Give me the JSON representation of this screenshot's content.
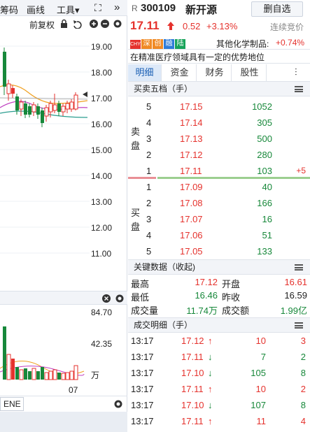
{
  "toolbar": {
    "item1": "筹码",
    "item2": "画线",
    "item3": "工具▾",
    "expand_glyph": "⛶",
    "more_glyph": "»"
  },
  "subbar": {
    "adjust": "前复权"
  },
  "price_axis": [
    "19.00",
    "18.00",
    "17.00",
    "16.00",
    "15.00",
    "14.00",
    "13.00",
    "12.00",
    "11.00"
  ],
  "volume_axis": {
    "top": "84.70",
    "mid": "42.35",
    "unit": "万"
  },
  "date_label": "07",
  "indicator_tab": "ENE",
  "stock": {
    "prefix": "R",
    "code": "300109",
    "name": "新开源",
    "remove_button": "删自选",
    "price": "17.11",
    "change": "0.52",
    "change_pct": "+3.13%",
    "auction_status": "连续竞价",
    "badges": [
      {
        "text": "CHY",
        "color": "#e5322d"
      },
      {
        "text": "深",
        "color": "#f08a24"
      },
      {
        "text": "创",
        "color": "#f08a24"
      },
      {
        "text": "融",
        "color": "#2f7cd8"
      },
      {
        "text": "陆",
        "color": "#17a35a"
      }
    ],
    "industry_label": "其他化学制品:",
    "industry_change": "+0.74%",
    "tagline": "在精准医疗领域具有一定的优势地位"
  },
  "tabs": [
    "明细",
    "资金",
    "财务",
    "股性"
  ],
  "orderbook": {
    "title": "买卖五档（手）",
    "sell_label": "卖盘",
    "buy_label": "买盘",
    "sell": [
      {
        "level": "5",
        "price": "17.15",
        "volume": "1052"
      },
      {
        "level": "4",
        "price": "17.14",
        "volume": "305"
      },
      {
        "level": "3",
        "price": "17.13",
        "volume": "500"
      },
      {
        "level": "2",
        "price": "17.12",
        "volume": "280"
      },
      {
        "level": "1",
        "price": "17.11",
        "volume": "103",
        "delta": "+5"
      }
    ],
    "buy": [
      {
        "level": "1",
        "price": "17.09",
        "volume": "40"
      },
      {
        "level": "2",
        "price": "17.08",
        "volume": "166"
      },
      {
        "level": "3",
        "price": "17.07",
        "volume": "16"
      },
      {
        "level": "4",
        "price": "17.06",
        "volume": "51"
      },
      {
        "level": "5",
        "price": "17.05",
        "volume": "133"
      }
    ]
  },
  "keydata": {
    "title": "关键数据（收起)",
    "high_label": "最高",
    "high": "17.12",
    "open_label": "开盘",
    "open": "16.61",
    "low_label": "最低",
    "low": "16.46",
    "prev_label": "昨收",
    "prev": "16.59",
    "vol_label": "成交量",
    "vol": "11.74万",
    "amt_label": "成交额",
    "amt": "1.99亿"
  },
  "trades": {
    "title": "成交明细（手）",
    "rows": [
      {
        "time": "13:17",
        "price": "17.12",
        "dir": "up",
        "vol": "10",
        "count": "3"
      },
      {
        "time": "13:17",
        "price": "17.11",
        "dir": "down",
        "vol": "7",
        "count": "2"
      },
      {
        "time": "13:17",
        "price": "17.10",
        "dir": "down",
        "vol": "105",
        "count": "8"
      },
      {
        "time": "13:17",
        "price": "17.11",
        "dir": "up",
        "vol": "10",
        "count": "2"
      },
      {
        "time": "13:17",
        "price": "17.10",
        "dir": "down",
        "vol": "107",
        "count": "8"
      },
      {
        "time": "13:17",
        "price": "17.11",
        "dir": "up",
        "vol": "11",
        "count": "4"
      }
    ]
  },
  "colors": {
    "up": "#e5322d",
    "down": "#17883a",
    "tab_active_bg": "#dde9f8"
  }
}
